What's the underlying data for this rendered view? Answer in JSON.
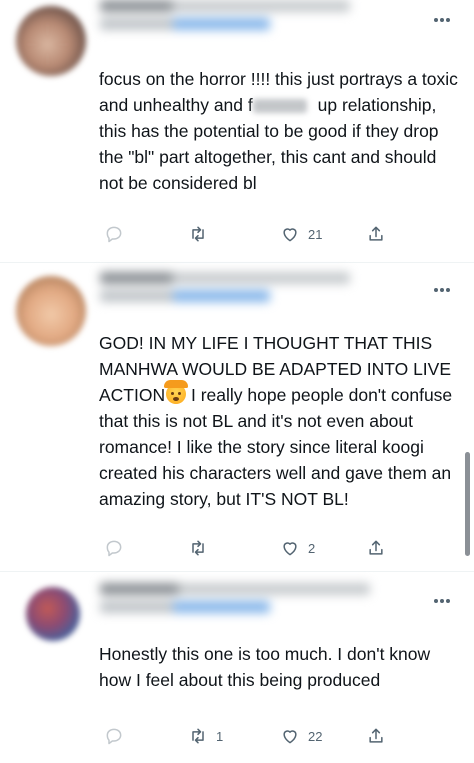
{
  "tweets": [
    {
      "text_before": "focus on the horror !!!! this just portrays a toxic and unhealthy and f",
      "text_after": " up relationship, this has the potential to be good if they drop the \"bl\" part altogether, this cant and should not be considered bl",
      "actions": {
        "reply_count": "",
        "retweet_count": "",
        "like_count": "21"
      },
      "icons": [
        "reply-icon",
        "retweet-icon",
        "like-icon",
        "share-icon",
        "more-icon"
      ]
    },
    {
      "text_before": "GOD! IN MY LIFE I THOUGHT THAT THIS MANHWA WOULD BE ADAPTED INTO LIVE ACTION",
      "text_after": " I really hope people don't confuse that this is not BL and it's not even about romance! I like the story since literal koogi created his characters well and gave them an amazing story, but IT'S NOT BL!",
      "emoji": "exploding-head-emoji",
      "actions": {
        "reply_count": "",
        "retweet_count": "",
        "like_count": "2"
      },
      "icons": [
        "reply-icon",
        "retweet-icon",
        "like-icon",
        "share-icon",
        "more-icon"
      ]
    },
    {
      "text": "Honestly this one is too much. I don't know how I feel about this being produced",
      "actions": {
        "reply_count": "",
        "retweet_count": "1",
        "like_count": "22"
      },
      "icons": [
        "reply-icon",
        "retweet-icon",
        "like-icon",
        "share-icon",
        "more-icon"
      ]
    }
  ],
  "colors": {
    "text": "#0f1419",
    "secondary": "#536471",
    "divider": "#eff3f4",
    "link": "#1d9bf0"
  }
}
